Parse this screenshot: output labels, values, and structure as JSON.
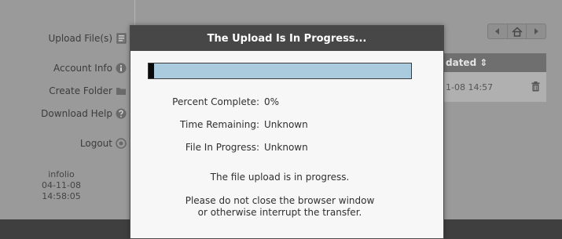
{
  "sidebar": {
    "items": [
      {
        "label": "Upload File(s)",
        "icon": "upload-file-icon"
      },
      {
        "label": "Account Info",
        "icon": "info-icon"
      },
      {
        "label": "Create Folder",
        "icon": "folder-icon"
      },
      {
        "label": "Download Help",
        "icon": "help-icon"
      },
      {
        "label": "Logout",
        "icon": "logout-icon"
      }
    ],
    "info": {
      "username": "infolio",
      "date": "04-11-08",
      "time": "14:58:05"
    }
  },
  "toolbar": {
    "buttons": [
      "back-icon",
      "home-icon",
      "forward-icon"
    ]
  },
  "table": {
    "column_header": "dated ⇕",
    "rows": [
      {
        "updated": "1-08 14:57"
      }
    ]
  },
  "modal": {
    "title": "The Upload Is In Progress...",
    "progress": {
      "fraction": 0.02
    },
    "percent_label": "Percent Complete:",
    "percent_value": "0%",
    "time_label": "Time Remaining:",
    "time_value": "Unknown",
    "file_label": "File In Progress:",
    "file_value": "Unknown",
    "message1": "The file upload is in progress.",
    "message2_line1": "Please do not close the browser window",
    "message2_line2": "or otherwise interrupt the transfer."
  },
  "colors": {
    "overlay_bg": "#9a9a9a",
    "modal_header": "#474747",
    "progress_track": "#a9cbdd",
    "progress_fill": "#0a0a0a",
    "table_header": "#6f6f6f"
  }
}
